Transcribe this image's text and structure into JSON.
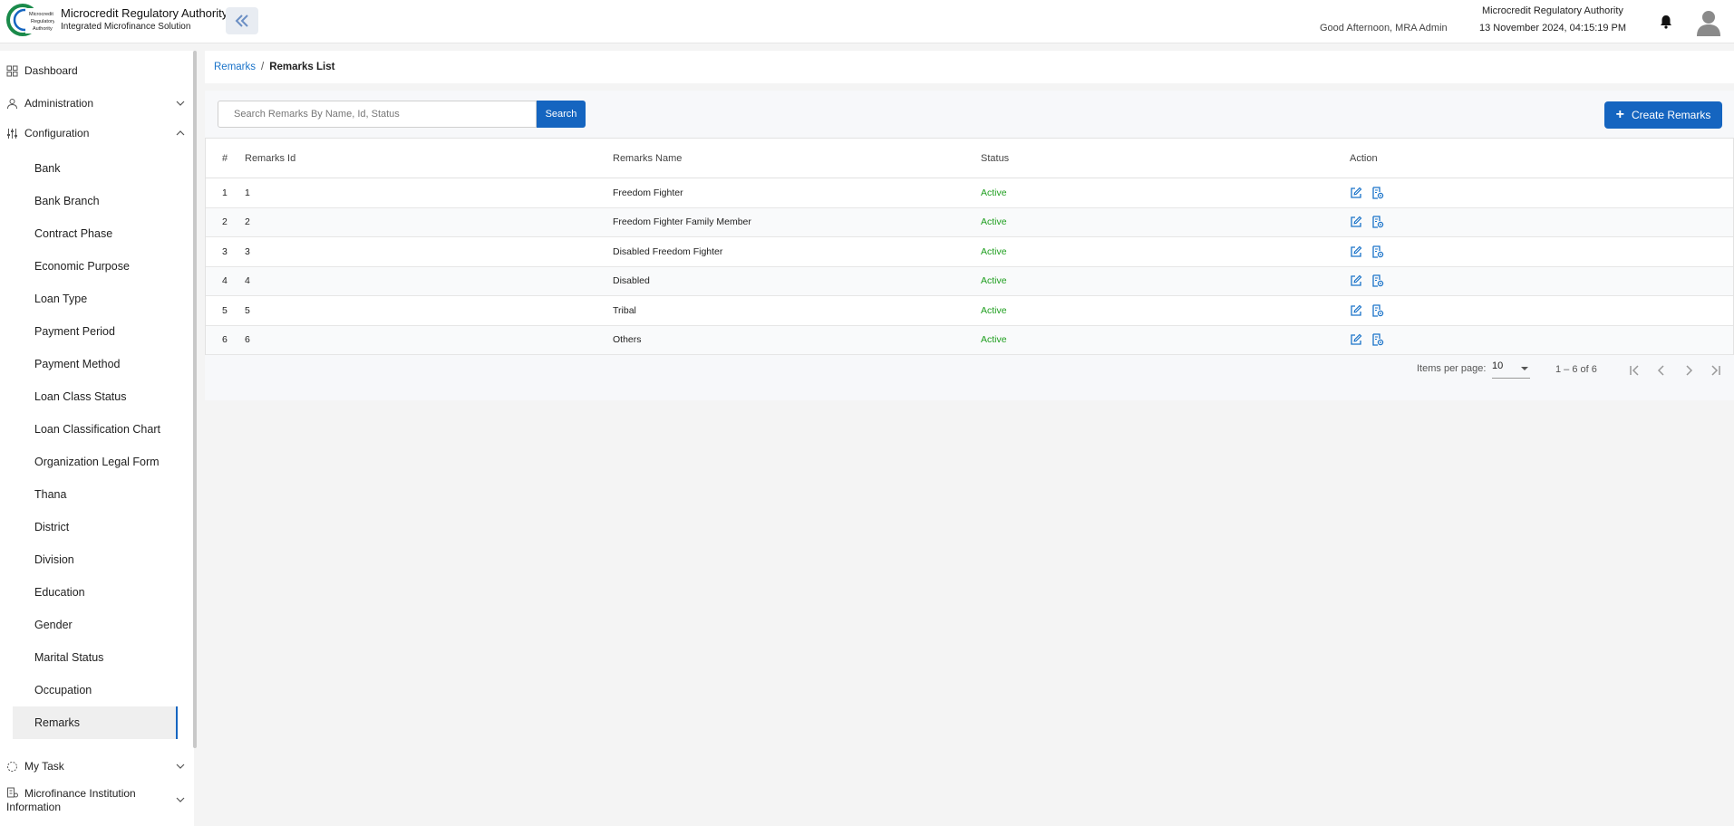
{
  "header": {
    "app_title": "Microcredit Regulatory Authority",
    "app_subtitle": "Integrated Microfinance Solution",
    "logo_text": "Microcredit Regulatory Authority",
    "greeting": "Good Afternoon, MRA Admin",
    "org_name": "Microcredit Regulatory Authority",
    "datetime": "13 November 2024, 04:15:19 PM"
  },
  "sidebar": {
    "top_items": [
      {
        "label": "Dashboard"
      },
      {
        "label": "Administration"
      },
      {
        "label": "Configuration"
      }
    ],
    "config_items": [
      {
        "label": "Bank"
      },
      {
        "label": "Bank Branch"
      },
      {
        "label": "Contract Phase"
      },
      {
        "label": "Economic Purpose"
      },
      {
        "label": "Loan Type"
      },
      {
        "label": "Payment Period"
      },
      {
        "label": "Payment Method"
      },
      {
        "label": "Loan Class Status"
      },
      {
        "label": "Loan Classification Chart"
      },
      {
        "label": "Organization Legal Form"
      },
      {
        "label": "Thana"
      },
      {
        "label": "District"
      },
      {
        "label": "Division"
      },
      {
        "label": "Education"
      },
      {
        "label": "Gender"
      },
      {
        "label": "Marital Status"
      },
      {
        "label": "Occupation"
      },
      {
        "label": "Remarks"
      }
    ],
    "bottom_items": [
      {
        "label": "My Task"
      },
      {
        "label": "Microfinance Institution",
        "label2": "Information"
      }
    ]
  },
  "breadcrumb": {
    "link": "Remarks",
    "separator": "/",
    "current": "Remarks List"
  },
  "toolbar": {
    "search_placeholder": "Search Remarks By Name, Id, Status",
    "search_value": "",
    "search_label": "Search",
    "create_label": "Create Remarks"
  },
  "table": {
    "headers": {
      "index": "#",
      "id": "Remarks Id",
      "name": "Remarks Name",
      "status": "Status",
      "action": "Action"
    },
    "rows": [
      {
        "index": "1",
        "id": "1",
        "name": "Freedom Fighter",
        "status": "Active"
      },
      {
        "index": "2",
        "id": "2",
        "name": "Freedom Fighter Family Member",
        "status": "Active"
      },
      {
        "index": "3",
        "id": "3",
        "name": "Disabled Freedom Fighter",
        "status": "Active"
      },
      {
        "index": "4",
        "id": "4",
        "name": "Disabled",
        "status": "Active"
      },
      {
        "index": "5",
        "id": "5",
        "name": "Tribal",
        "status": "Active"
      },
      {
        "index": "6",
        "id": "6",
        "name": "Others",
        "status": "Active"
      }
    ]
  },
  "pagination": {
    "items_per_page_label": "Items per page:",
    "items_per_page": "10",
    "range": "1 – 6 of 6"
  },
  "colors": {
    "primary": "#1565c0",
    "link": "#1a73c9",
    "status_active": "#1e9e1e"
  }
}
